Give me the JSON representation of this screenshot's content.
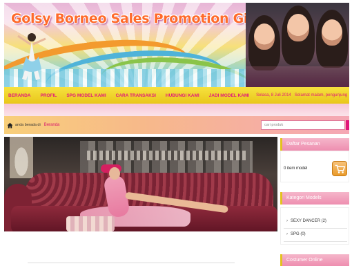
{
  "header": {
    "site_title": "Golsy Borneo Sales Promotion Girls Agency"
  },
  "nav": {
    "items": [
      "BERANDA",
      "PROFIL",
      "SPG MODEL KAMI",
      "CARA TRANSAKSI",
      "HUBUNGI KAMI",
      "JADI MODEL KAMI"
    ],
    "date_text": "Selasa, 8 Juli 2014",
    "greeting": "Selamat malam, pengunjung"
  },
  "breadcrumb": {
    "label": "anda berada di",
    "current": "Beranda"
  },
  "search": {
    "placeholder": "cari produk"
  },
  "sidebar": {
    "cart": {
      "title": "Daftar Pesanan",
      "items_text": "0 item model"
    },
    "categories": {
      "title": "Kategori Models",
      "items": [
        "SEXY DANCER (2)",
        "SPG (0)"
      ]
    },
    "online": {
      "title": "Costumer Online"
    }
  },
  "colors": {
    "nav_bg": "#f6e23f",
    "nav_text": "#e0187a",
    "sidebar_head": "#ee8eb0",
    "title_orange": "#ff6a2b"
  },
  "icons": {
    "home": "home-icon",
    "cart": "cart-icon",
    "chevron": "chevron-right-icon"
  }
}
